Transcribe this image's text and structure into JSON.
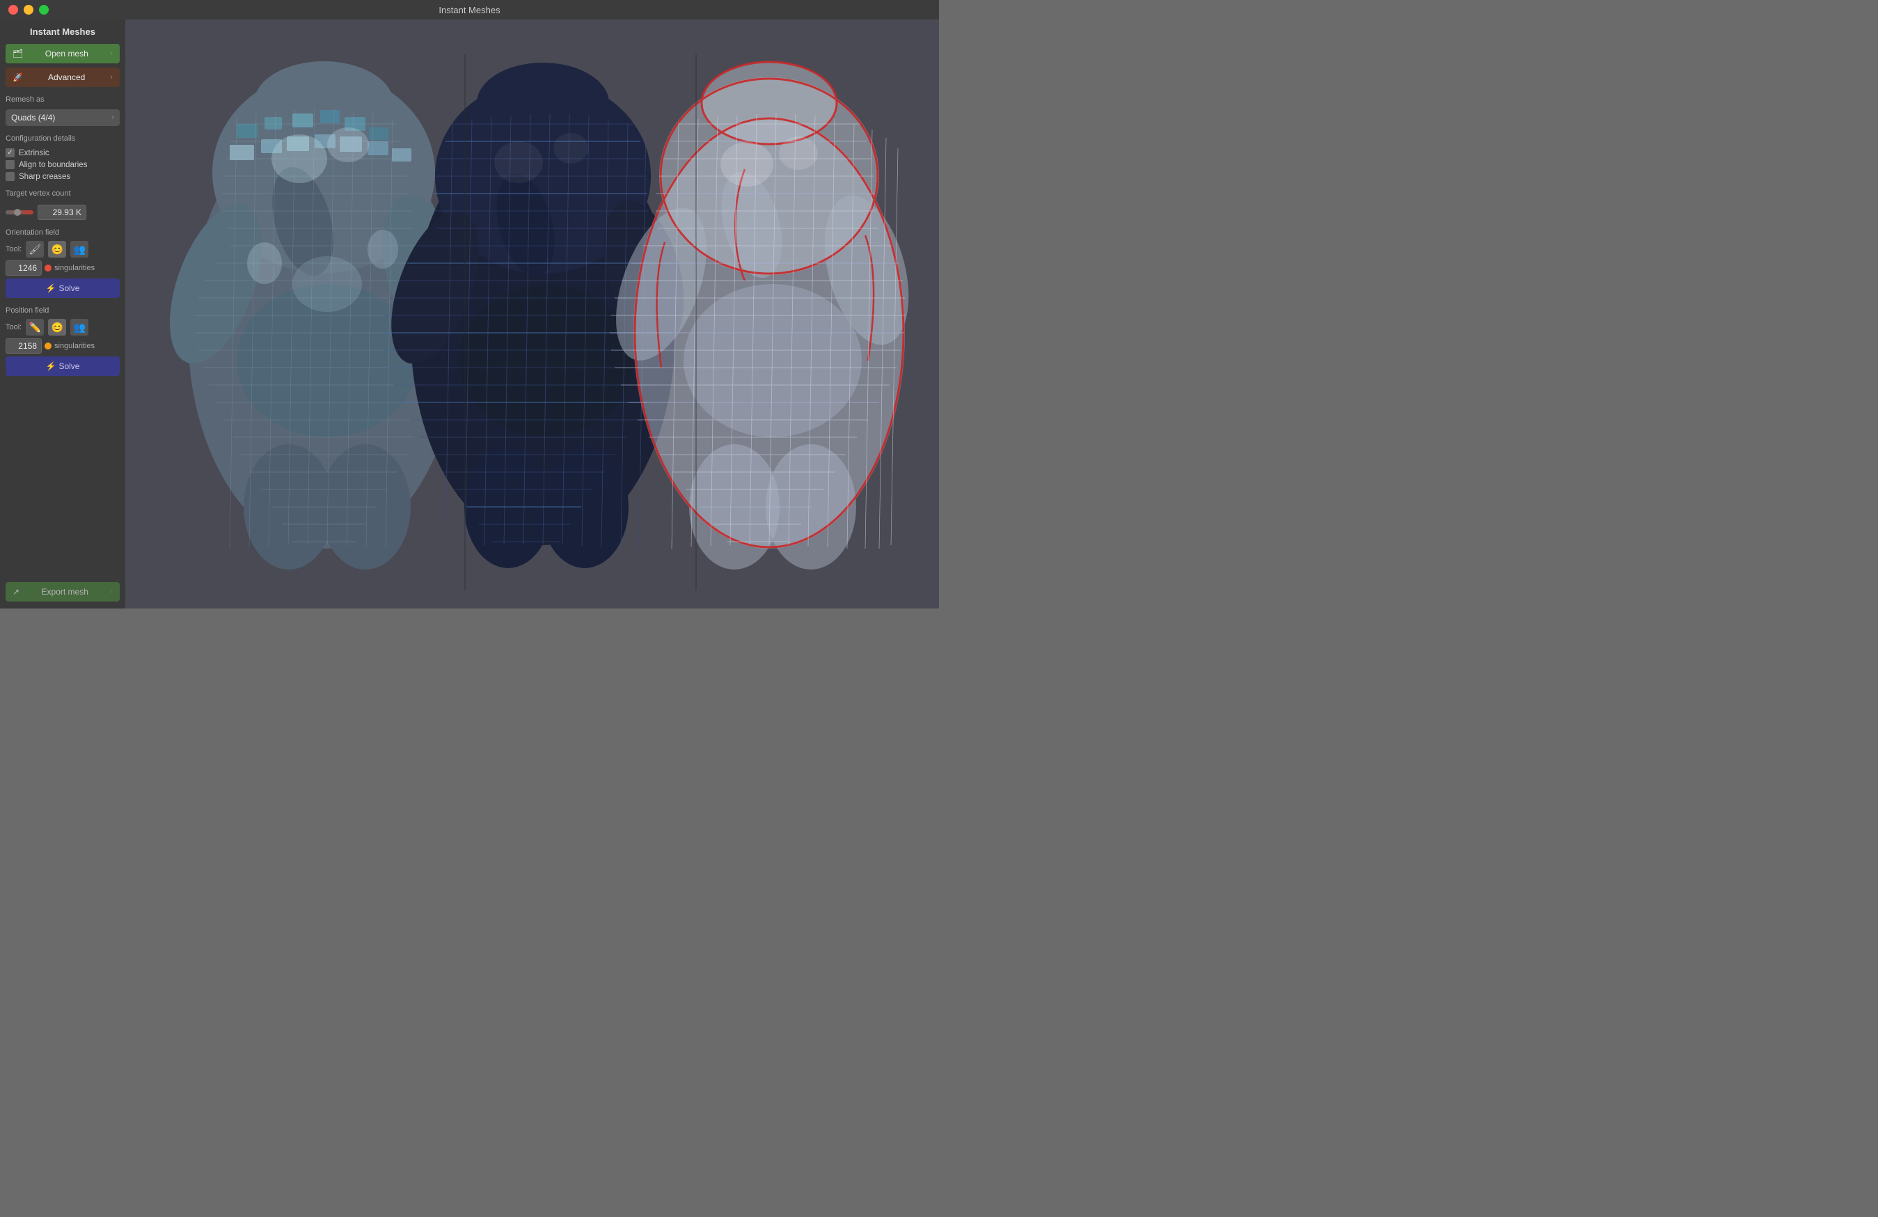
{
  "titlebar": {
    "title": "Instant Meshes"
  },
  "sidebar": {
    "title": "Instant Meshes",
    "open_mesh_label": "Open mesh",
    "advanced_label": "Advanced",
    "remesh_as_label": "Remesh as",
    "remesh_as_value": "Quads (4/4)",
    "config_details_label": "Configuration details",
    "extrinsic_label": "Extrinsic",
    "extrinsic_checked": true,
    "align_boundaries_label": "Align to boundaries",
    "align_boundaries_checked": false,
    "sharp_creases_label": "Sharp creases",
    "sharp_creases_checked": false,
    "target_vertex_label": "Target vertex count",
    "vertex_count_value": "29.93 K",
    "orientation_field_label": "Orientation field",
    "tool_label": "Tool:",
    "orientation_singularities": "1246",
    "singularities_label": "singularities",
    "solve_label": "⚡ Solve",
    "position_field_label": "Position field",
    "position_tool_label": "Tool:",
    "position_singularities": "2158",
    "export_mesh_label": "Export mesh"
  },
  "colors": {
    "open_mesh_bg": "#4a7c3f",
    "advanced_bg": "#5a3a2a",
    "solve_bg": "#3a3a8a",
    "export_bg": "#4a7c3f",
    "orientation_sing_color": "#e74c3c",
    "position_sing_color": "#f39c12",
    "viewport_bg": "#4a4a54"
  }
}
